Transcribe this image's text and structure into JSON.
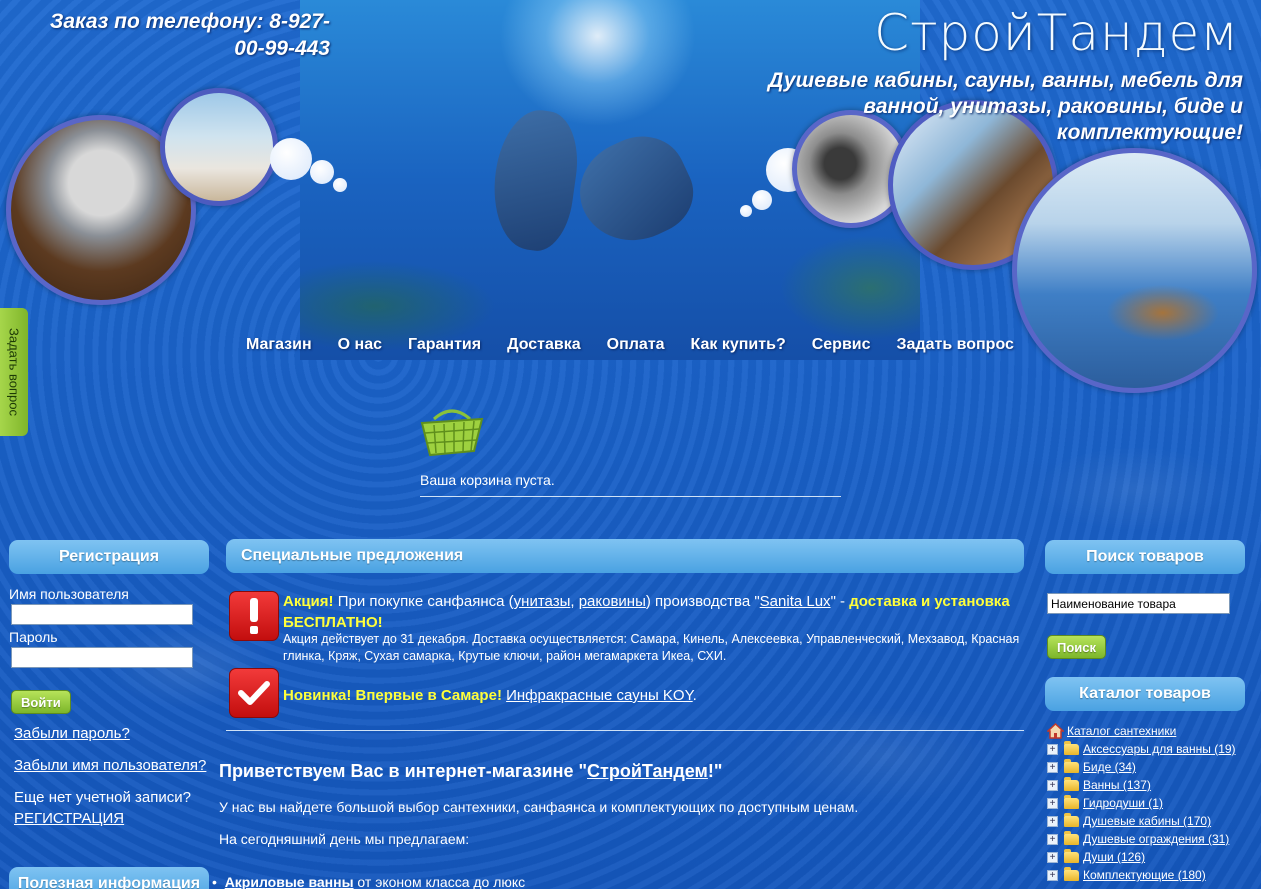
{
  "header": {
    "phone": "Заказ по телефону: 8-927-00-99-443",
    "site_title": "СтройТандем",
    "tagline": "Душевые кабины, сауны, ванны, мебель для ванной, унитазы, раковины, биде и комплектующие!"
  },
  "nav": [
    "Магазин",
    "О нас",
    "Гарантия",
    "Доставка",
    "Оплата",
    "Как купить?",
    "Сервис",
    "Задать вопрос"
  ],
  "side_tab": "Задать вопрос",
  "cart": {
    "status": "Ваша корзина пуста."
  },
  "login": {
    "title": "Регистрация",
    "username_label": "Имя пользователя",
    "password_label": "Пароль",
    "submit": "Войти",
    "forgot_password": "Забыли пароль?",
    "forgot_username": "Забыли имя пользователя?",
    "no_account": "Еще нет учетной записи?",
    "register": "РЕГИСТРАЦИЯ"
  },
  "useful_info": {
    "title": "Полезная информация"
  },
  "specials": {
    "title": "Специальные предложения",
    "promo1": {
      "label": "Акция!",
      "text_before": " При покупке санфаянса (",
      "link1": "унитазы",
      "sep": ", ",
      "link2": "раковины",
      "text_mid": ") производства \"",
      "link3": "Sanita Lux",
      "text_after": "\" - ",
      "highlight": "доставка и установка БЕСПЛАТНО!",
      "details": "Акция действует до 31 декабря. Доставка осуществляется: Самара, Кинель, Алексеевка, Управленческий, Мехзавод, Красная глинка, Кряж, Сухая самарка, Крутые ключи, район мегамаркета Икеа, СХИ."
    },
    "promo2": {
      "label": "Новинка! Впервые в Самаре!",
      "link": "Инфракрасные сауны KOY",
      "end": "."
    }
  },
  "welcome": {
    "title_before": "Приветствуем Вас в интернет-магазине \"",
    "title_link": "СтройТандем",
    "title_after": "!\"",
    "para1": "У нас вы найдете большой выбор сантехники, санфаянса и комплектующих по доступным ценам.",
    "para2": "На сегодняшний день мы предлагаем:",
    "list_item_link": "Акриловые ванны",
    "list_item_text": " от эконом класса до люкс"
  },
  "search": {
    "title": "Поиск товаров",
    "placeholder": "Наименование товара",
    "button": "Поиск"
  },
  "catalog": {
    "title": "Каталог товаров",
    "root": "Каталог сантехники",
    "items": [
      "Аксессуары для ванны (19)",
      "Биде (34)",
      "Ванны (137)",
      "Гидродуши (1)",
      "Душевые кабины (170)",
      "Душевые ограждения (31)",
      "Души (126)",
      "Комплектующие (180)"
    ]
  },
  "colors": {
    "accent_yellow": "#ffff3a",
    "box_header": "#4aa2e2",
    "button_green": "#7cb62a"
  }
}
